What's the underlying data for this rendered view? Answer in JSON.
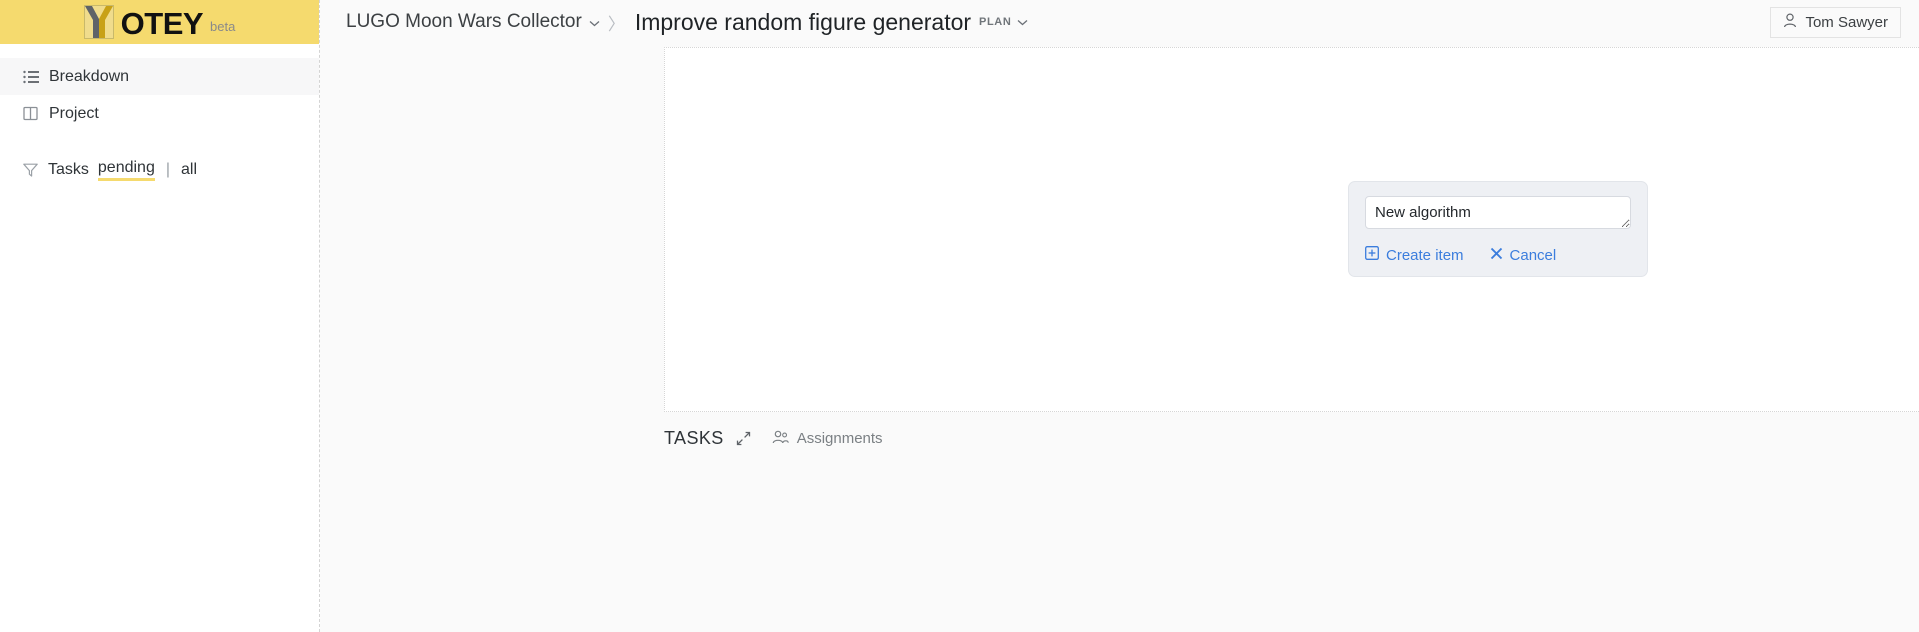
{
  "sidebar": {
    "logo": {
      "mark": "y-logo-icon",
      "text": "OTEY",
      "beta": "beta"
    },
    "items": [
      {
        "label": "Breakdown",
        "icon": "list-icon",
        "active": true
      },
      {
        "label": "Project",
        "icon": "book-icon",
        "active": false
      }
    ],
    "filter": {
      "icon": "filter-icon",
      "label": "Tasks",
      "options": [
        {
          "label": "pending",
          "active": true
        },
        {
          "label": "all",
          "active": false
        }
      ],
      "separator": "|"
    }
  },
  "topbar": {
    "breadcrumb": {
      "project": "LUGO Moon Wars Collector",
      "separator": "〉",
      "title": "Improve random figure generator",
      "badge": "PLAN"
    },
    "user": {
      "name": "Tom Sawyer",
      "icon": "person-icon"
    }
  },
  "dialog": {
    "input_value": "New algorithm",
    "input_placeholder": "",
    "create_label": "Create item",
    "create_icon": "plus-box-icon",
    "cancel_label": "Cancel",
    "cancel_icon": "close-icon"
  },
  "canvas_tools": [
    {
      "name": "add-icon"
    },
    {
      "name": "expand-icon"
    },
    {
      "name": "info-icon"
    }
  ],
  "tasks": {
    "title": "TASKS",
    "collapse_icon": "collapse-icon",
    "assignments_label": "Assignments",
    "assignments_icon": "people-icon"
  },
  "colors": {
    "brand_yellow": "#f5da6e",
    "link_blue": "#3b7ddd",
    "text_primary": "#2f3438",
    "text_muted": "#7b8084",
    "dialog_bg": "#eef0f4"
  }
}
